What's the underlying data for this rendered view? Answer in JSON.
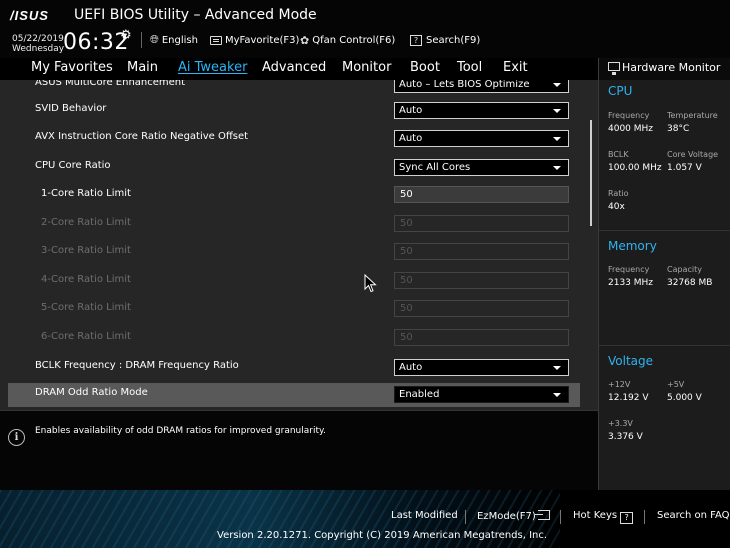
{
  "header": {
    "brand": "/ISUS",
    "title": "UEFI BIOS Utility – Advanced Mode",
    "date": "05/22/2019",
    "weekday": "Wednesday",
    "time": "06:32",
    "language": "English",
    "myfavorite": "MyFavorite(F3)",
    "qfan": "Qfan Control(F6)",
    "search": "Search(F9)",
    "search_icon_glyph": "?"
  },
  "nav": {
    "tabs": [
      {
        "label": "My Favorites",
        "active": false
      },
      {
        "label": "Main",
        "active": false
      },
      {
        "label": "Ai Tweaker",
        "active": true
      },
      {
        "label": "Advanced",
        "active": false
      },
      {
        "label": "Monitor",
        "active": false
      },
      {
        "label": "Boot",
        "active": false
      },
      {
        "label": "Tool",
        "active": false
      },
      {
        "label": "Exit",
        "active": false
      }
    ]
  },
  "settings": [
    {
      "label": "ASUS MultiCore Enhancement",
      "value": "Auto – Lets BIOS Optimize",
      "kind": "dropdown"
    },
    {
      "label": "SVID Behavior",
      "value": "Auto",
      "kind": "dropdown"
    },
    {
      "label": "AVX Instruction Core Ratio Negative Offset",
      "value": "Auto",
      "kind": "dropdown"
    },
    {
      "label": "CPU Core Ratio",
      "value": "Sync All Cores",
      "kind": "dropdown"
    },
    {
      "label": "1-Core Ratio Limit",
      "value": "50",
      "kind": "number",
      "enabled": true
    },
    {
      "label": "2-Core Ratio Limit",
      "value": "50",
      "kind": "number",
      "enabled": false
    },
    {
      "label": "3-Core Ratio Limit",
      "value": "50",
      "kind": "number",
      "enabled": false
    },
    {
      "label": "4-Core Ratio Limit",
      "value": "50",
      "kind": "number",
      "enabled": false
    },
    {
      "label": "5-Core Ratio Limit",
      "value": "50",
      "kind": "number",
      "enabled": false
    },
    {
      "label": "6-Core Ratio Limit",
      "value": "50",
      "kind": "number",
      "enabled": false
    },
    {
      "label": "BCLK Frequency : DRAM Frequency Ratio",
      "value": "Auto",
      "kind": "dropdown"
    },
    {
      "label": "DRAM Odd Ratio Mode",
      "value": "Enabled",
      "kind": "dropdown",
      "selected": true
    }
  ],
  "help": {
    "info_glyph": "i",
    "text": "Enables availability of odd DRAM ratios for improved granularity."
  },
  "hardware_monitor": {
    "title": "Hardware Monitor",
    "cpu": {
      "heading": "CPU",
      "frequency_label": "Frequency",
      "frequency": "4000 MHz",
      "temperature_label": "Temperature",
      "temperature": "38°C",
      "bclk_label": "BCLK",
      "bclk": "100.00 MHz",
      "core_voltage_label": "Core Voltage",
      "core_voltage": "1.057 V",
      "ratio_label": "Ratio",
      "ratio": "40x"
    },
    "memory": {
      "heading": "Memory",
      "frequency_label": "Frequency",
      "frequency": "2133 MHz",
      "capacity_label": "Capacity",
      "capacity": "32768 MB"
    },
    "voltage": {
      "heading": "Voltage",
      "v12_label": "+12V",
      "v12": "12.192 V",
      "v5_label": "+5V",
      "v5": "5.000 V",
      "v33_label": "+3.3V",
      "v33": "3.376 V"
    }
  },
  "footer": {
    "last_modified": "Last Modified",
    "ezmode": "EzMode(F7)",
    "hotkeys": "Hot Keys",
    "hotkeys_glyph": "?",
    "search_faq": "Search on FAQ",
    "version": "Version 2.20.1271. Copyright (C) 2019 American Megatrends, Inc."
  },
  "colors": {
    "accent": "#29b6f6",
    "panel": "#262626",
    "selected_row": "#595959"
  }
}
